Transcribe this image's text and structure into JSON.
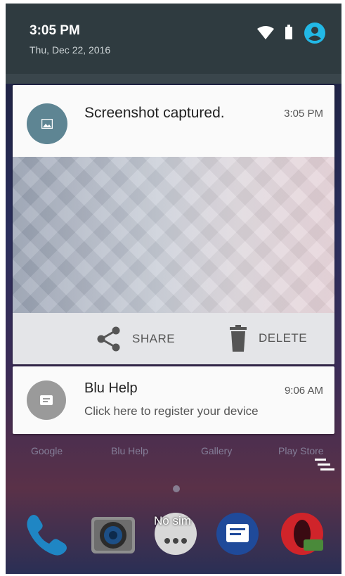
{
  "header": {
    "time": "3:05 PM",
    "date": "Thu, Dec 22, 2016"
  },
  "icons": {
    "wifi": "wifi-icon",
    "battery": "battery-icon",
    "user": "user-account-icon"
  },
  "notifications": [
    {
      "title": "Screenshot captured.",
      "time": "3:05 PM",
      "icon": "image-icon",
      "actions": [
        {
          "label": "SHARE",
          "icon": "share-icon"
        },
        {
          "label": "DELETE",
          "icon": "trash-icon"
        }
      ]
    },
    {
      "title": "Blu Help",
      "time": "9:06 AM",
      "text": "Click here to register your device",
      "icon": "message-icon"
    }
  ],
  "home": {
    "app_labels": [
      "Google",
      "Blu Help",
      "Gallery",
      "Play Store"
    ],
    "dock_status": "No sim"
  },
  "colors": {
    "header_bg": "#2f3b40",
    "accent_blue": "#22b8e6",
    "screenshot_icon_bg": "#5e8593",
    "help_icon_bg": "#9a9a9a"
  }
}
